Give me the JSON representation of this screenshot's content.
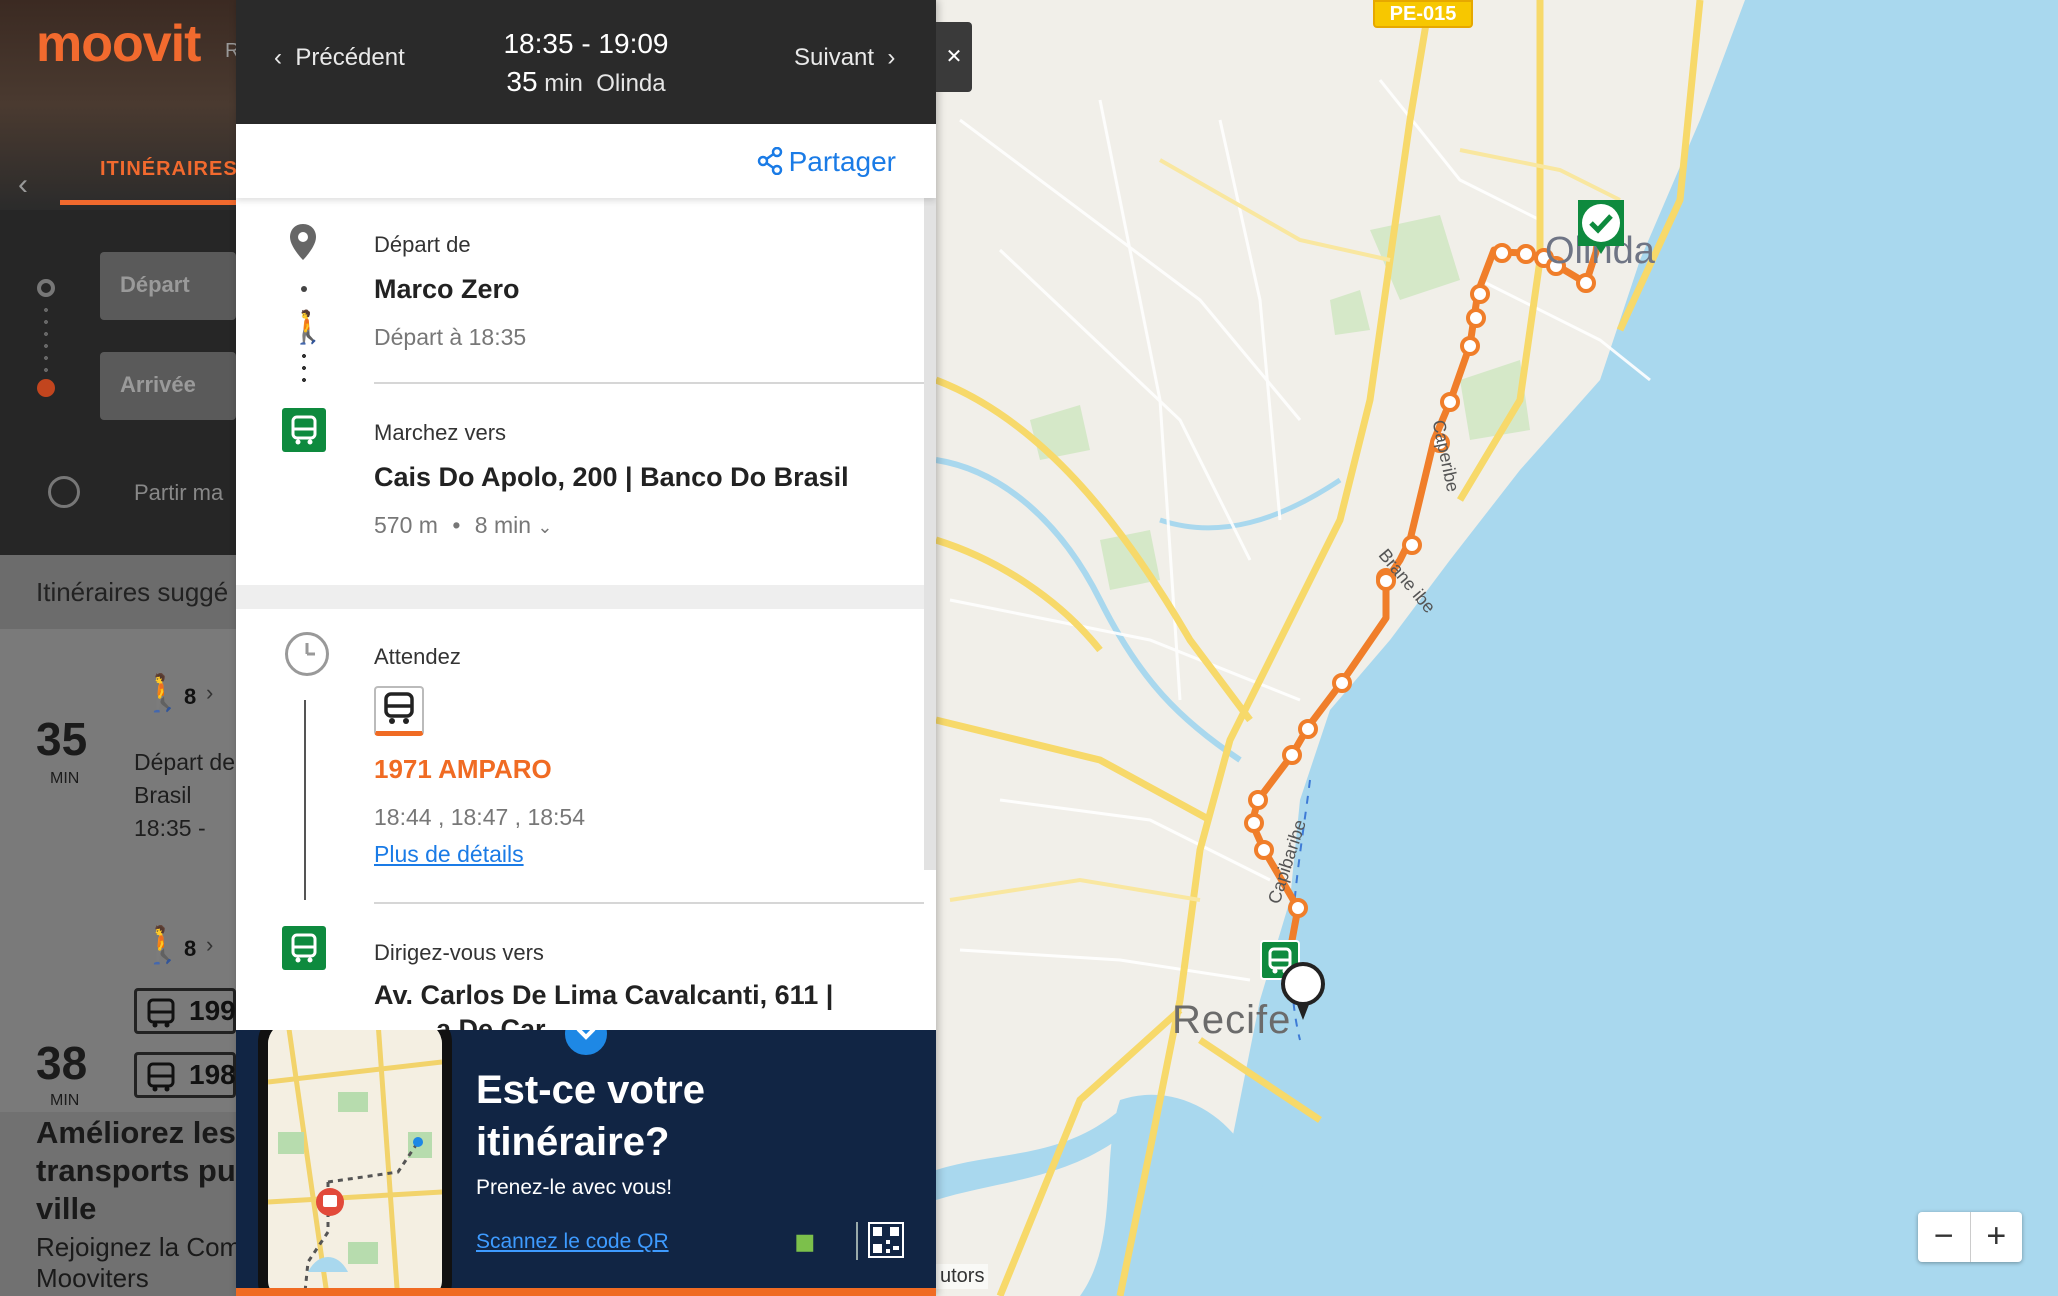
{
  "header": {
    "logo": "moovit",
    "logo_suffix": "R",
    "tab_itineraries": "ITINÉRAIRES",
    "departure_placeholder": "Départ",
    "arrival_placeholder": "Arrivée",
    "leave_now": "Partir ma"
  },
  "results": {
    "heading": "Itinéraires suggé",
    "items": [
      {
        "duration": "35",
        "unit": "MIN",
        "walk_minutes": "8",
        "line1": "Départ de",
        "line2": "Brasil",
        "line3": "18:35 -"
      },
      {
        "duration": "38",
        "unit": "MIN",
        "walk_minutes": "8",
        "bus1": "199",
        "bus2": "198"
      }
    ]
  },
  "left_promo": {
    "title_lines": [
      "Améliorez les",
      "transports pub",
      "ville"
    ],
    "sub_lines": [
      "Rejoignez la Com",
      "Mooviters"
    ]
  },
  "detail": {
    "prev_label": "Précédent",
    "next_label": "Suivant",
    "time_range": "18:35  -  19:09",
    "duration_value": "35",
    "duration_unit": "min",
    "destination": "Olinda",
    "share_label": "Partager",
    "steps": {
      "start_label": "Départ de",
      "start_title": "Marco Zero",
      "start_meta": "Départ à 18:35",
      "walk_label": "Marchez vers",
      "walk_title": "Cais Do Apolo, 200 | Banco Do Brasil",
      "walk_distance": "570 m",
      "walk_time": "8 min",
      "wait_label": "Attendez",
      "line_name": "1971 AMPARO",
      "departures": "18:44 , 18:47 , 18:54",
      "more_details": "Plus de détails",
      "goto_label": "Dirigez-vous vers",
      "goto_title_1": "Av. Carlos De Lima Cavalcanti, 611 |",
      "goto_title_2": "a De Car"
    }
  },
  "promo": {
    "title_1": "Est-ce votre",
    "title_2": "itinéraire?",
    "subtitle": "Prenez-le avec vous!",
    "qr_link": "Scannez le code QR"
  },
  "map": {
    "city_recife": "Recife",
    "city_olinda": "Olinda",
    "highway_sign": "PE-015",
    "road_1": "Caperibe",
    "road_2": "Brane ibe",
    "road_3": "Capibaribe",
    "attribution": "utors",
    "zoom_out": "−",
    "zoom_in": "+"
  },
  "colors": {
    "brand_orange": "#f06b23",
    "link_blue": "#1a7be6",
    "transit_green": "#0e8a3e",
    "promo_navy": "#112544"
  }
}
